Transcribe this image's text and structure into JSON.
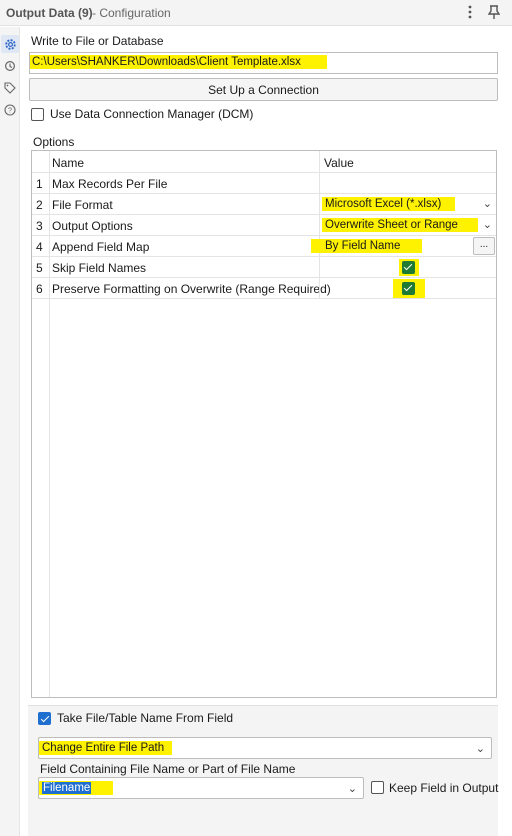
{
  "titlebar": {
    "title": "Output Data (9)",
    "subtitle": "- Configuration",
    "menu_icon": "more-vertical-icon",
    "pin_icon": "pin-icon"
  },
  "rail": {
    "icons": [
      "gear-icon",
      "refresh-icon",
      "tag-icon",
      "help-icon"
    ]
  },
  "write_section": {
    "label": "Write to File or Database",
    "path_value": "C:\\Users\\SHANKER\\Downloads\\Client Template.xlsx",
    "setup_button": "Set Up a Connection",
    "dcm_label": "Use Data Connection Manager (DCM)",
    "dcm_checked": false
  },
  "options": {
    "label": "Options",
    "columns": [
      "Name",
      "Value"
    ],
    "rows": [
      {
        "num": "1",
        "name": "Max Records Per File",
        "value": ""
      },
      {
        "num": "2",
        "name": "File Format",
        "value": "Microsoft Excel (*.xlsx)"
      },
      {
        "num": "3",
        "name": "Output Options",
        "value": "Overwrite Sheet or Range"
      },
      {
        "num": "4",
        "name": "Append Field Map",
        "value": "By Field Name",
        "button": "..."
      },
      {
        "num": "5",
        "name": "Skip Field Names",
        "value": "checked"
      },
      {
        "num": "6",
        "name": "Preserve Formatting on Overwrite (Range Required)",
        "value": "checked"
      }
    ]
  },
  "bottom": {
    "take_name_label": "Take File/Table Name From Field",
    "take_name_checked": true,
    "mode_value": "Change Entire File Path",
    "field_label": "Field Containing File Name or Part of File Name",
    "field_value": "Filename",
    "keep_label": "Keep Field in Output",
    "keep_checked": false
  },
  "colors": {
    "highlight": "#fff200",
    "accent": "#1e6fd0",
    "grid_check": "#1f7a33"
  }
}
